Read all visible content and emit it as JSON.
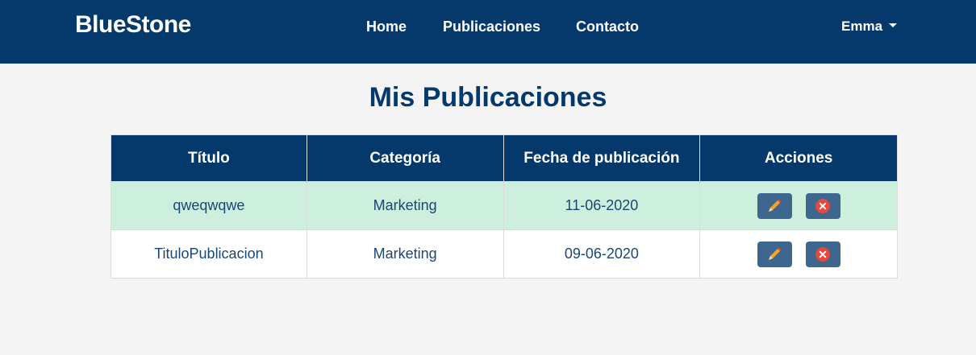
{
  "brand": "BlueStone",
  "nav": {
    "home": "Home",
    "publications": "Publicaciones",
    "contact": "Contacto",
    "user": "Emma"
  },
  "page_title": "Mis Publicaciones",
  "table": {
    "headers": [
      "Título",
      "Categoría",
      "Fecha de publicación",
      "Acciones"
    ],
    "rows": [
      {
        "title": "qweqwqwe",
        "category": "Marketing",
        "date": "11-06-2020"
      },
      {
        "title": "TituloPublicacion",
        "category": "Marketing",
        "date": "09-06-2020"
      }
    ]
  },
  "icons": {
    "edit": "pencil-icon",
    "delete": "close-circle-icon"
  },
  "colors": {
    "primary": "#05396b",
    "highlight_row": "#cdf0de",
    "action_button": "#3e678f",
    "delete_icon": "#e8473d"
  }
}
